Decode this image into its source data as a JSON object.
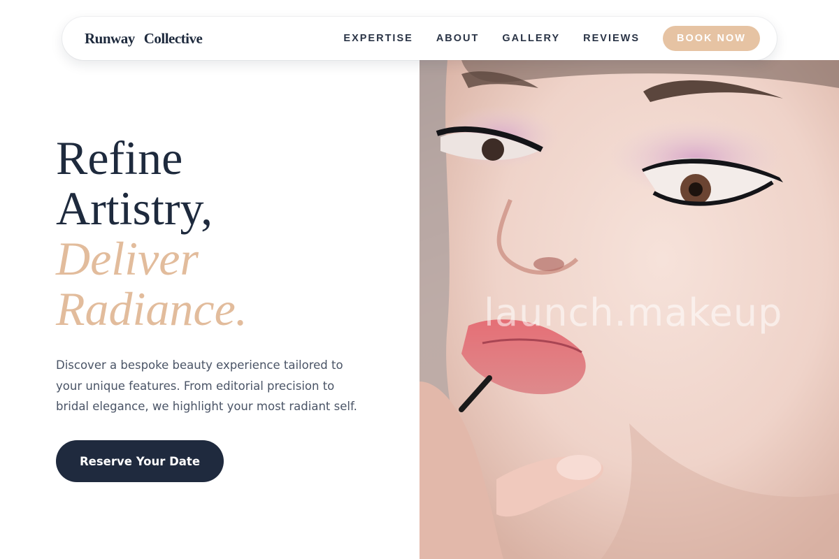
{
  "brand": {
    "word1": "Runway",
    "word2": "Collective"
  },
  "nav": {
    "links": [
      "EXPERTISE",
      "ABOUT",
      "GALLERY",
      "REVIEWS"
    ],
    "cta_label": "BOOK NOW"
  },
  "hero": {
    "line1": "Refine",
    "line2": "Artistry,",
    "line3": "Deliver",
    "line4": "Radiance.",
    "description": "Discover a bespoke beauty experience tailored to your unique features. From editorial precision to bridal elegance, we highlight your most radiant self.",
    "cta_label": "Reserve Your Date",
    "watermark": "launch.makeup"
  },
  "colors": {
    "navy": "#1e2a3d",
    "accent": "#e2bc9c",
    "button_peach": "#e6c3a3",
    "body_text": "#4a5466"
  }
}
